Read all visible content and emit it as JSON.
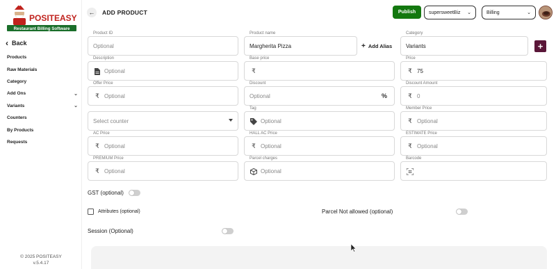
{
  "sidebar": {
    "brand_name": "POSITEASY",
    "brand_tagline": "Restaurant Billing Software",
    "back_label": "Back",
    "items": [
      {
        "label": "Products",
        "has_chevron": false
      },
      {
        "label": "Raw Materials",
        "has_chevron": false
      },
      {
        "label": "Category",
        "has_chevron": false
      },
      {
        "label": "Add Ons",
        "has_chevron": true
      },
      {
        "label": "Variants",
        "has_chevron": true
      },
      {
        "label": "Counters",
        "has_chevron": false
      },
      {
        "label": "By Products",
        "has_chevron": false
      },
      {
        "label": "Requests",
        "has_chevron": false
      }
    ],
    "copyright": "© 2025 POSITEASY",
    "version": "v.5.4.17"
  },
  "header": {
    "title": "ADD PRODUCT",
    "publish_label": "Publish",
    "business_select": "supersweetBiz",
    "mode_select": "Billing"
  },
  "form": {
    "product_id": {
      "label": "Product ID",
      "placeholder": "Optional",
      "value": ""
    },
    "product_name": {
      "label": "Product name",
      "value": "Margherita Pizza"
    },
    "add_alias_label": "Add Alias",
    "category": {
      "label": "Category",
      "value": "Variants"
    },
    "description": {
      "label": "Description",
      "placeholder": "Optional"
    },
    "base_price": {
      "label": "Base price",
      "value": ""
    },
    "price": {
      "label": "Price",
      "value": "75"
    },
    "offer_price": {
      "label": "Offer Price",
      "placeholder": "Optional"
    },
    "discount": {
      "label": "Discount",
      "placeholder": "Optional",
      "suffix": "%"
    },
    "discount_amount": {
      "label": "Discount Amount",
      "placeholder": "0"
    },
    "counter": {
      "placeholder": "Select counter"
    },
    "tag": {
      "label": "Tag",
      "placeholder": "Optional"
    },
    "member_price": {
      "label": "Member Price",
      "placeholder": "Optional"
    },
    "ac_price": {
      "label": "AC Price",
      "placeholder": "Optional"
    },
    "hall_ac_price": {
      "label": "HALL AC Price",
      "placeholder": "Optional"
    },
    "estimate_price": {
      "label": "ESTIMATE Price",
      "placeholder": "Optional"
    },
    "premium_price": {
      "label": "PREMIUM Price",
      "placeholder": "Optional"
    },
    "parcel_charges": {
      "label": "Parcel charges",
      "placeholder": "Optional"
    },
    "barcode": {
      "label": "Barcode",
      "placeholder": ""
    }
  },
  "options": {
    "gst_label": "GST (optional)",
    "gst_enabled": false,
    "attributes_label": "Attributes (optional)",
    "attributes_checked": false,
    "parcel_not_allowed_label": "Parcel Not allowed (optional)",
    "parcel_not_allowed_enabled": false,
    "session_label": "Session (Optional)",
    "session_enabled": false
  },
  "icons": {
    "rupee": "₹",
    "percent": "%",
    "back_arrow": "←",
    "add": "+"
  },
  "colors": {
    "publish": "#13780f",
    "add_category": "#5a1638",
    "field_border": "#d8d8d8"
  }
}
